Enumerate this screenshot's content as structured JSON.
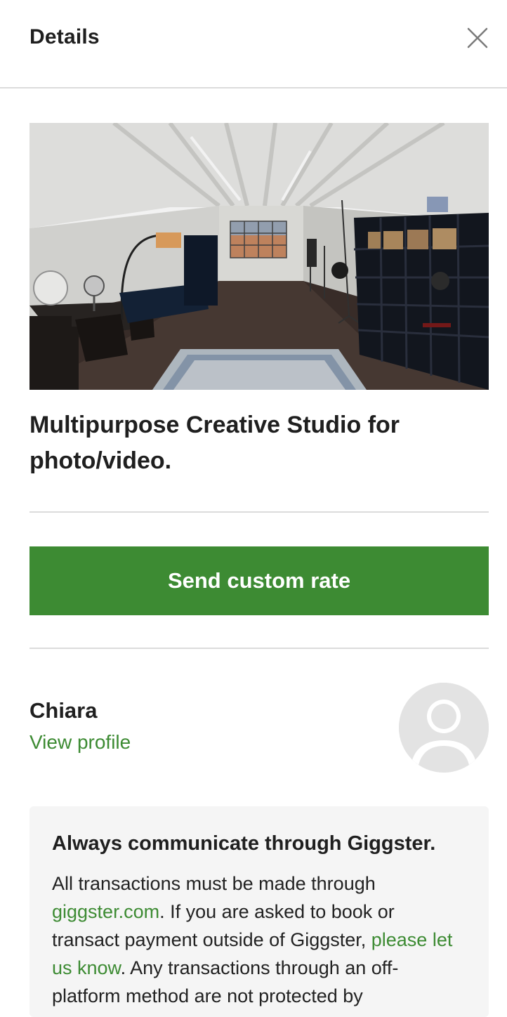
{
  "header": {
    "title": "Details",
    "close_icon": "close-icon"
  },
  "listing": {
    "title": "Multipurpose Creative Studio for photo/video."
  },
  "actions": {
    "send_custom_rate_label": "Send custom rate"
  },
  "host": {
    "name": "Chiara",
    "view_profile_label": "View profile",
    "avatar_icon": "user-avatar-icon"
  },
  "notice": {
    "title": "Always communicate through Giggster.",
    "body_part1": "All transactions must be made through ",
    "link_site": "giggster.com",
    "body_part2": ". If you are asked to book or transact payment outside of Giggster, ",
    "link_report": "please let us know",
    "body_part3": ". Any transactions through an off-platform method are not protected by"
  },
  "colors": {
    "accent_green": "#3d8b33",
    "divider": "#dcdcdc",
    "notice_bg": "#f5f5f5"
  }
}
